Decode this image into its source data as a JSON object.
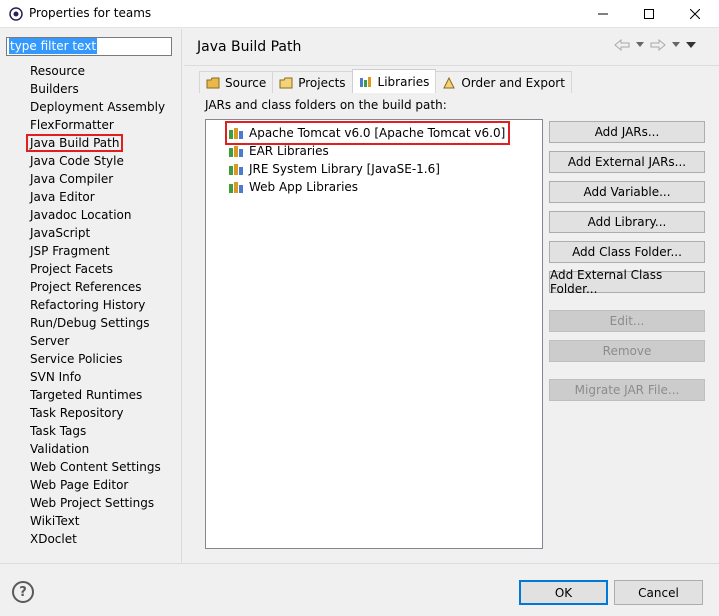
{
  "window": {
    "title": "Properties for teams"
  },
  "filter": {
    "value": "type filter text"
  },
  "nav": {
    "items": [
      "Resource",
      "Builders",
      "Deployment Assembly",
      "FlexFormatter",
      "Java Build Path",
      "Java Code Style",
      "Java Compiler",
      "Java Editor",
      "Javadoc Location",
      "JavaScript",
      "JSP Fragment",
      "Project Facets",
      "Project References",
      "Refactoring History",
      "Run/Debug Settings",
      "Server",
      "Service Policies",
      "SVN Info",
      "Targeted Runtimes",
      "Task Repository",
      "Task Tags",
      "Validation",
      "Web Content Settings",
      "Web Page Editor",
      "Web Project Settings",
      "WikiText",
      "XDoclet"
    ],
    "selected": "Java Build Path"
  },
  "page": {
    "title": "Java Build Path"
  },
  "tabs": [
    "Source",
    "Projects",
    "Libraries",
    "Order and Export"
  ],
  "active_tab": "Libraries",
  "libraries": {
    "label": "JARs and class folders on the build path:",
    "items": [
      "Apache Tomcat v6.0 [Apache Tomcat v6.0]",
      "EAR Libraries",
      "JRE System Library [JavaSE-1.6]",
      "Web App Libraries"
    ]
  },
  "buttons": {
    "add_jars": "Add JARs...",
    "add_external_jars": "Add External JARs...",
    "add_variable": "Add Variable...",
    "add_library": "Add Library...",
    "add_class_folder": "Add Class Folder...",
    "add_external_class_folder": "Add External Class Folder...",
    "edit": "Edit...",
    "remove": "Remove",
    "migrate_jar": "Migrate JAR File..."
  },
  "footer": {
    "ok": "OK",
    "cancel": "Cancel",
    "help": "?"
  },
  "colors": {
    "highlight": "#e02020",
    "selection": "#3399ff",
    "default_button_border": "#0078d7"
  }
}
